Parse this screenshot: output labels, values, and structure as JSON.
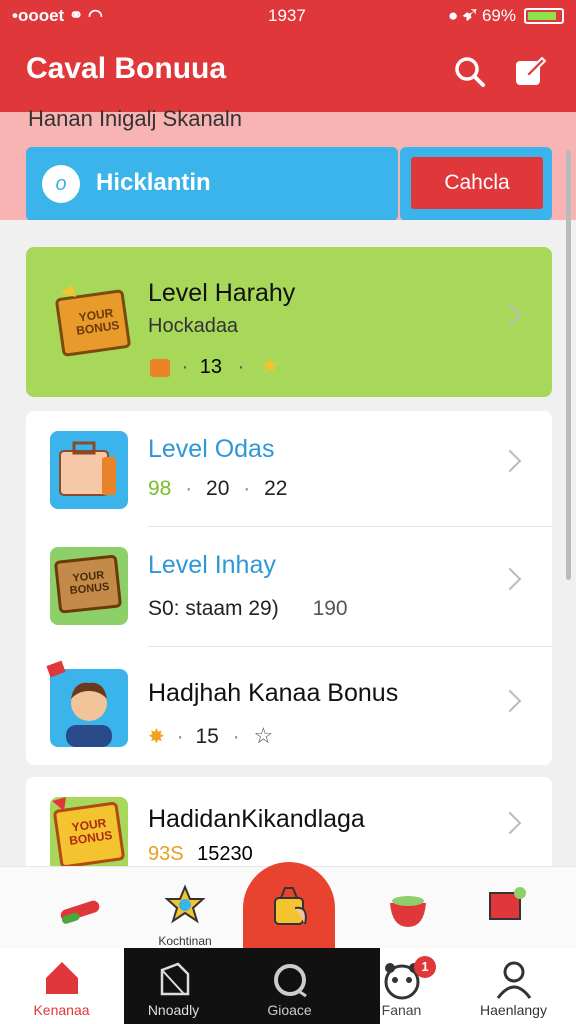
{
  "status_bar": {
    "carrier": "•oooet",
    "time": "1937",
    "battery_text": "69%"
  },
  "app_bar": {
    "title": "Caval Bonuua"
  },
  "subheader": {
    "text": "Hanan Inigalj Skanaln"
  },
  "search": {
    "value": "Hicklantin"
  },
  "cancel_label": "Cahcla",
  "featured": {
    "title": "Level Harahy",
    "subtitle": "Hockadaa",
    "count": "13",
    "badge_text": "YOUR BONUS"
  },
  "list": [
    {
      "title": "Level Odas",
      "meta": [
        "98",
        "20",
        "22"
      ]
    },
    {
      "title": "Level Inhay",
      "meta_text": "S0: staam 29)",
      "meta_extra": "190",
      "badge_text": "YOUR BONUS"
    },
    {
      "title": "Hadjhah Kanaa Bonus",
      "meta_value": "15"
    },
    {
      "title": "HadidanKikandlaga",
      "meta_a": "93S",
      "meta_b": "15230",
      "badge_text": "YOUR BONUS"
    }
  ],
  "tabbar_top": {
    "label_under_star": "Kochtinan"
  },
  "tabbar": [
    {
      "label": "Kenanaa"
    },
    {
      "label": "Nnoadly"
    },
    {
      "label": "Gioace"
    },
    {
      "label": "Fanan",
      "badge": "1"
    },
    {
      "label": "Haenlangy"
    }
  ],
  "colors": {
    "primary": "#e0373a",
    "accent": "#3bb3eb",
    "featured_bg": "#a8d85a",
    "level_blue": "#2e97d8"
  }
}
